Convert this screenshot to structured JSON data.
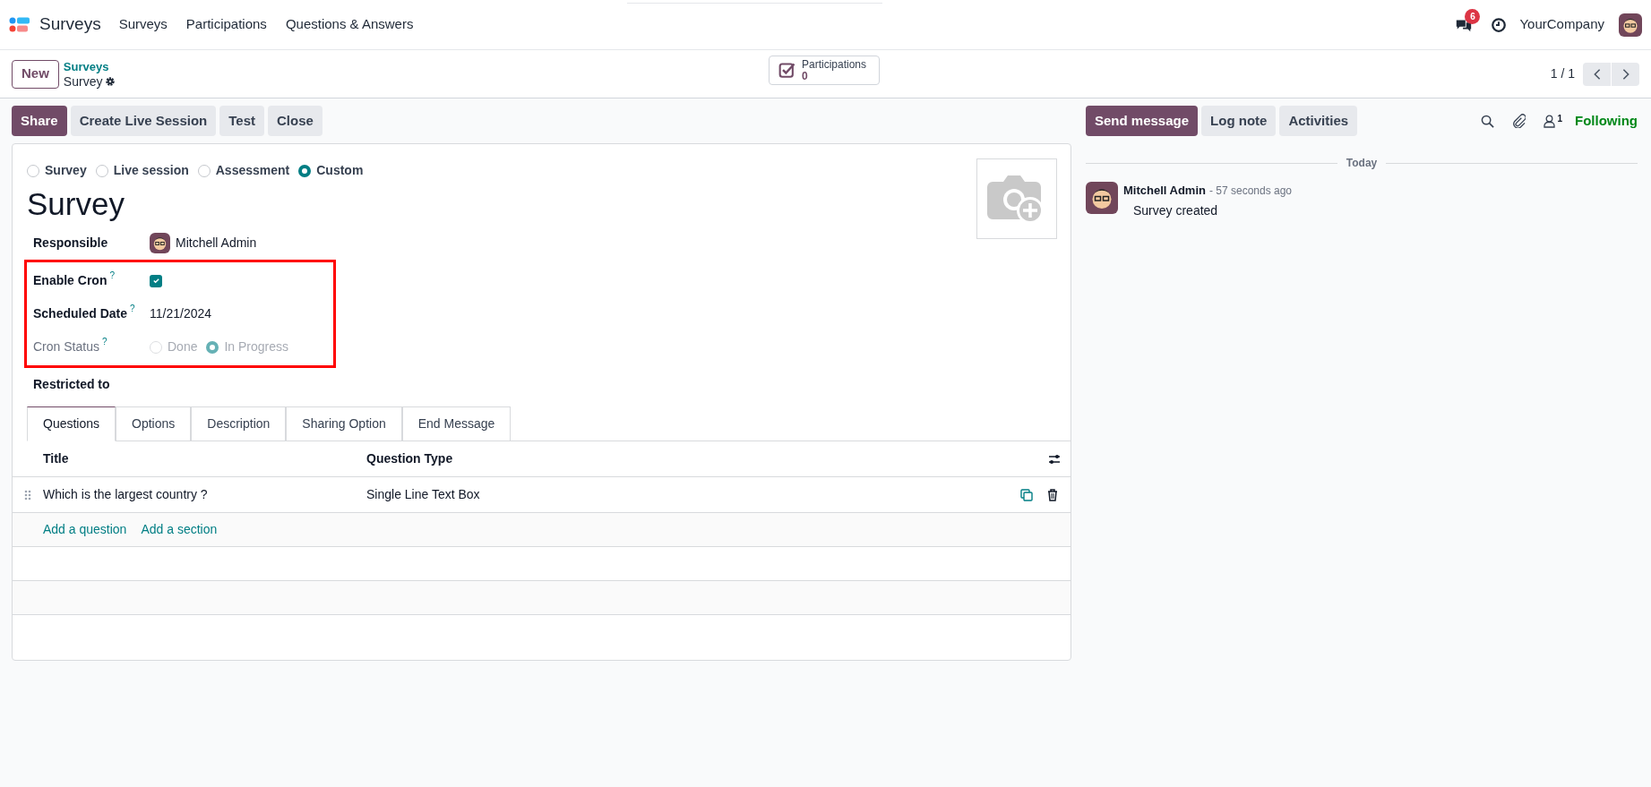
{
  "navbar": {
    "app_name": "Surveys",
    "menu": [
      "Surveys",
      "Participations",
      "Questions & Answers"
    ],
    "messages_badge": "6",
    "company": "YourCompany"
  },
  "control_panel": {
    "new_button": "New",
    "breadcrumb": "Surveys",
    "record": "Survey",
    "smart_button": {
      "label": "Participations",
      "value": "0"
    },
    "pager": "1 / 1"
  },
  "actions": [
    {
      "label": "Share",
      "kind": "primary"
    },
    {
      "label": "Create Live Session",
      "kind": "secondary"
    },
    {
      "label": "Test",
      "kind": "secondary"
    },
    {
      "label": "Close",
      "kind": "secondary"
    }
  ],
  "form": {
    "survey_types": [
      {
        "label": "Survey",
        "selected": false
      },
      {
        "label": "Live session",
        "selected": false
      },
      {
        "label": "Assessment",
        "selected": false
      },
      {
        "label": "Custom",
        "selected": true
      }
    ],
    "title": "Survey",
    "fields": [
      {
        "kind": "user",
        "label": "Responsible",
        "value": "Mitchell Admin",
        "highlighted": false
      },
      {
        "kind": "checkbox",
        "label": "Enable Cron",
        "help": "?",
        "checked": true,
        "highlighted": true
      },
      {
        "kind": "text",
        "label": "Scheduled Date",
        "help": "?",
        "value": "11/21/2024",
        "highlighted": true
      },
      {
        "kind": "radio",
        "label": "Cron Status",
        "help": "?",
        "readonly": true,
        "highlighted": true,
        "options": [
          {
            "label": "Done",
            "selected": false
          },
          {
            "label": "In Progress",
            "selected": true
          }
        ]
      },
      {
        "kind": "text",
        "label": "Restricted to",
        "highlighted": false
      }
    ],
    "tabs": [
      {
        "label": "Questions",
        "selected": true
      },
      {
        "label": "Options",
        "selected": false
      },
      {
        "label": "Description",
        "selected": false
      },
      {
        "label": "Sharing Option",
        "selected": false
      },
      {
        "label": "End Message",
        "selected": false
      }
    ],
    "table": {
      "columns": [
        "Title",
        "Question Type"
      ],
      "rows": [
        {
          "title": "Which is the largest country ?",
          "question_type": "Single Line Text Box"
        }
      ],
      "add_links": [
        "Add a question",
        "Add a section"
      ]
    }
  },
  "chatter": {
    "buttons": [
      {
        "label": "Send message",
        "kind": "primary"
      },
      {
        "label": "Log note",
        "kind": "secondary"
      },
      {
        "label": "Activities",
        "kind": "secondary"
      }
    ],
    "followers_count": "1",
    "following": "Following",
    "date_separator": "Today",
    "messages": [
      {
        "author": "Mitchell Admin",
        "time": "- 57 seconds ago",
        "body": "Survey created"
      }
    ]
  }
}
